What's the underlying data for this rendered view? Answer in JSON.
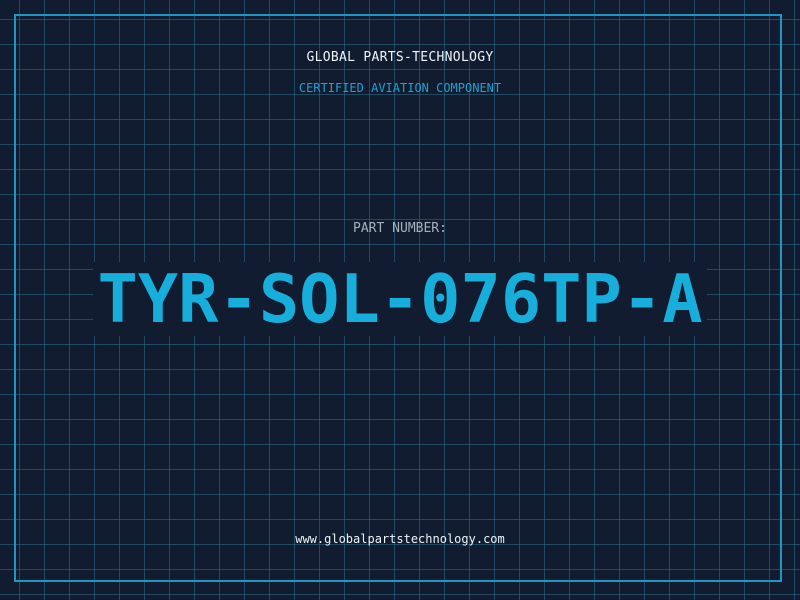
{
  "header": {
    "title": "GLOBAL PARTS-TECHNOLOGY",
    "subtitle": "CERTIFIED AVIATION COMPONENT"
  },
  "part": {
    "label": "PART NUMBER:",
    "number": "TYR-SOL-076TP-A"
  },
  "footer": {
    "url": "www.globalpartstechnology.com"
  },
  "colors": {
    "background": "#111c30",
    "grid": "#28708c",
    "frame": "#1a97c4",
    "accent": "#17aedb",
    "title_text": "#eef4fa",
    "label_text": "#a6b0bd"
  }
}
